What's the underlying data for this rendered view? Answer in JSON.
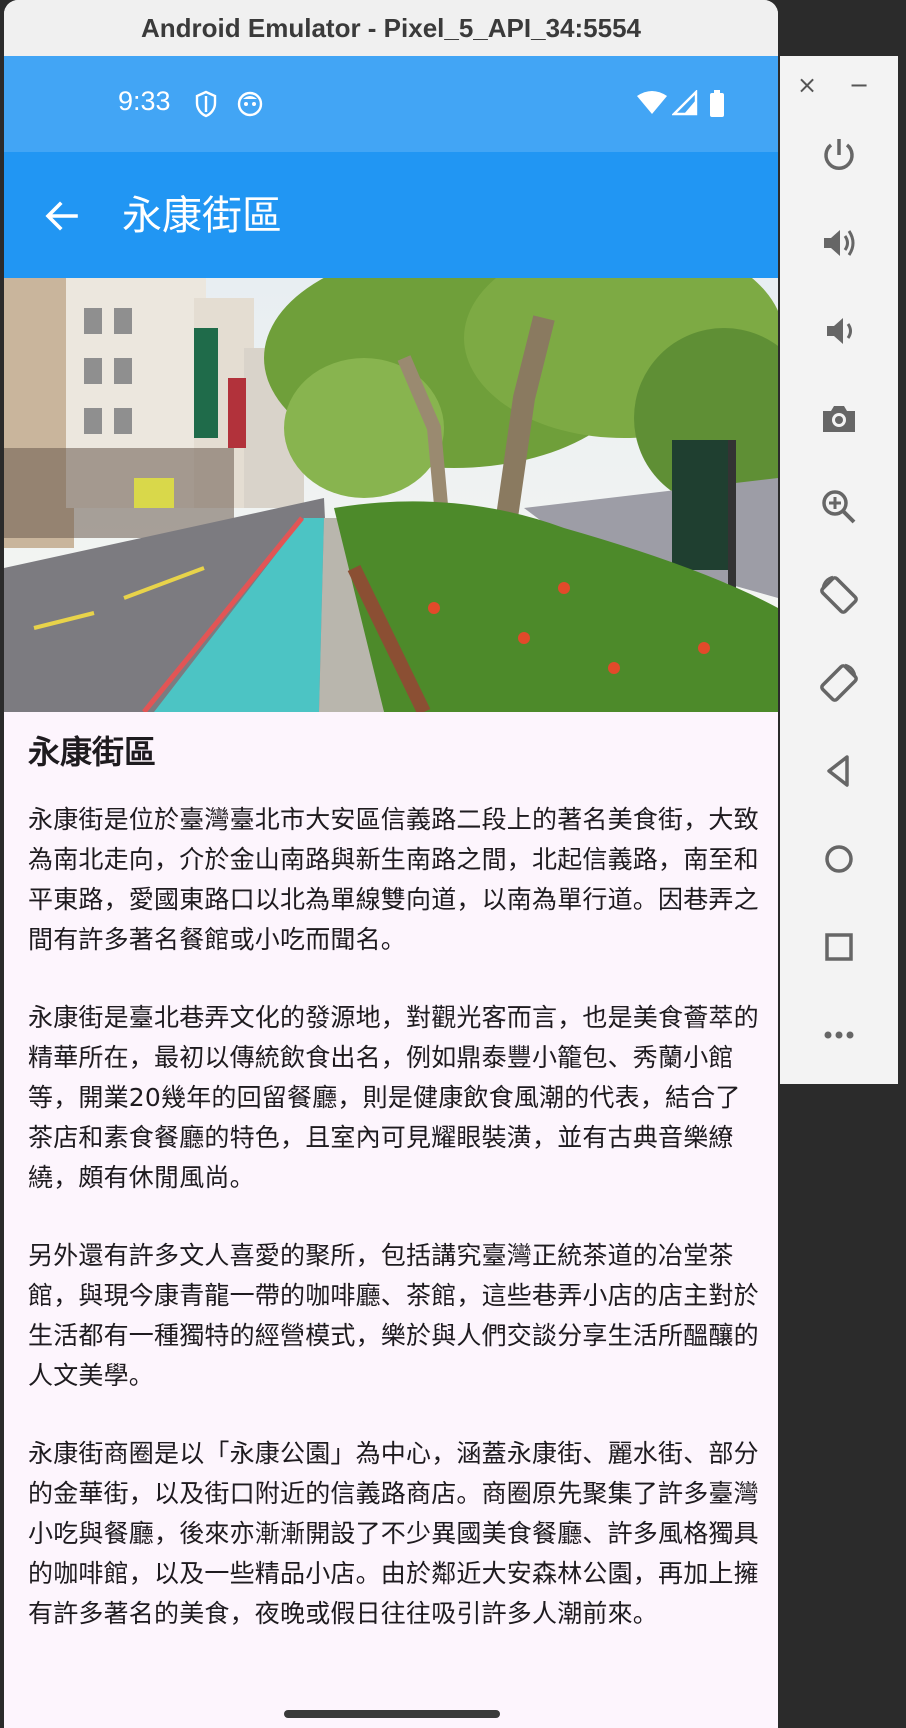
{
  "window": {
    "title": "Android Emulator - Pixel_5_API_34:5554"
  },
  "status_bar": {
    "time": "9:33"
  },
  "app_bar": {
    "title": "永康街區"
  },
  "hero_image": {
    "alt": "永康街區 street view"
  },
  "article": {
    "heading": "永康街區",
    "paragraphs": [
      "永康街是位於臺灣臺北市大安區信義路二段上的著名美食街，大致為南北走向，介於金山南路與新生南路之間，北起信義路，南至和平東路，愛國東路口以北為單線雙向道，以南為單行道。因巷弄之間有許多著名餐館或小吃而聞名。",
      "永康街是臺北巷弄文化的發源地，對觀光客而言，也是美食薈萃的精華所在，最初以傳統飲食出名，例如鼎泰豐小籠包、秀蘭小館等，開業20幾年的回留餐廳，則是健康飲食風潮的代表，結合了茶店和素食餐廳的特色，且室內可見耀眼裝潢，並有古典音樂繚繞，頗有休閒風尚。",
      "另外還有許多文人喜愛的聚所，包括講究臺灣正統茶道的冶堂茶館，與現今康青龍一帶的咖啡廳、茶館，這些巷弄小店的店主對於生活都有一種獨特的經營模式，樂於與人們交談分享生活所醞釀的人文美學。",
      "永康街商圈是以「永康公園」為中心，涵蓋永康街、麗水街、部分的金華街，以及街口附近的信義路商店。商圈原先聚集了許多臺灣小吃與餐廳，後來亦漸漸開設了不少異國美食餐廳、許多風格獨具的咖啡館，以及一些精品小店。由於鄰近大安森林公園，再加上擁有許多著名的美食，夜晚或假日往往吸引許多人潮前來。"
    ]
  },
  "side_toolbar": {
    "close": "×",
    "minimize": "−",
    "buttons": [
      "power-icon",
      "volume-up-icon",
      "volume-down-icon",
      "camera-icon",
      "zoom-icon",
      "rotate-left-icon",
      "rotate-right-icon",
      "back-icon",
      "home-icon",
      "overview-icon",
      "more-icon"
    ]
  },
  "colors": {
    "status_bar": "#42a5f5",
    "app_bar": "#2196f3",
    "background": "#fdf5fd"
  }
}
